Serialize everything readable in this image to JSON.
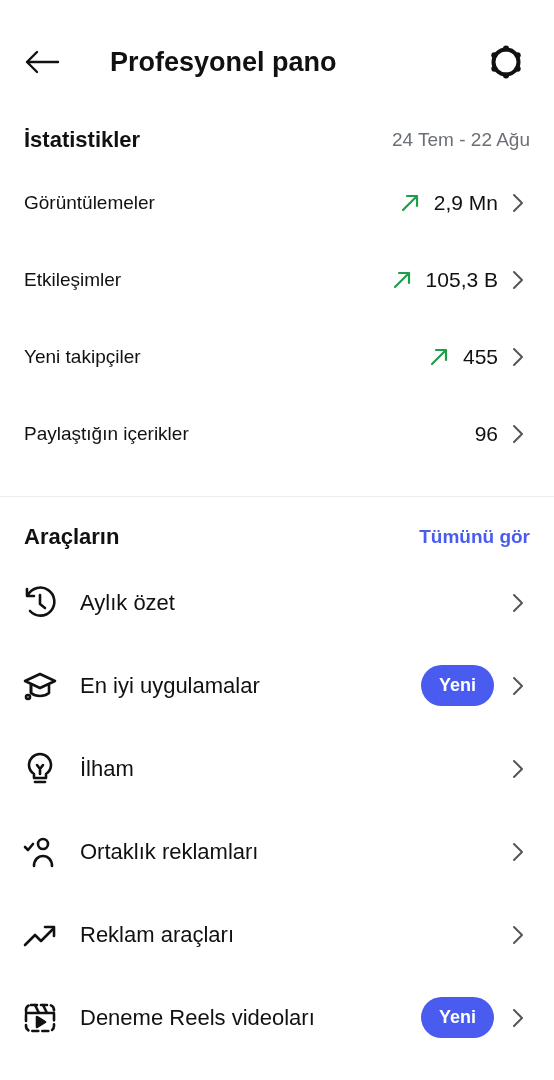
{
  "header": {
    "title": "Profesyonel pano"
  },
  "statistics": {
    "title": "İstatistikler",
    "date_range": "24 Tem - 22 Ağu",
    "rows": [
      {
        "label": "Görüntülemeler",
        "value": "2,9 Mn",
        "trending_up": true
      },
      {
        "label": "Etkileşimler",
        "value": "105,3 B",
        "trending_up": true
      },
      {
        "label": "Yeni takipçiler",
        "value": "455",
        "trending_up": true
      },
      {
        "label": "Paylaştığın içerikler",
        "value": "96",
        "trending_up": false
      }
    ]
  },
  "tools": {
    "title": "Araçların",
    "see_all": "Tümünü gör",
    "items": [
      {
        "label": "Aylık özet"
      },
      {
        "label": "En iyi uygulamalar",
        "badge": "Yeni"
      },
      {
        "label": "İlham"
      },
      {
        "label": "Ortaklık reklamları"
      },
      {
        "label": "Reklam araçları"
      },
      {
        "label": "Deneme Reels videoları",
        "badge": "Yeni"
      }
    ]
  }
}
